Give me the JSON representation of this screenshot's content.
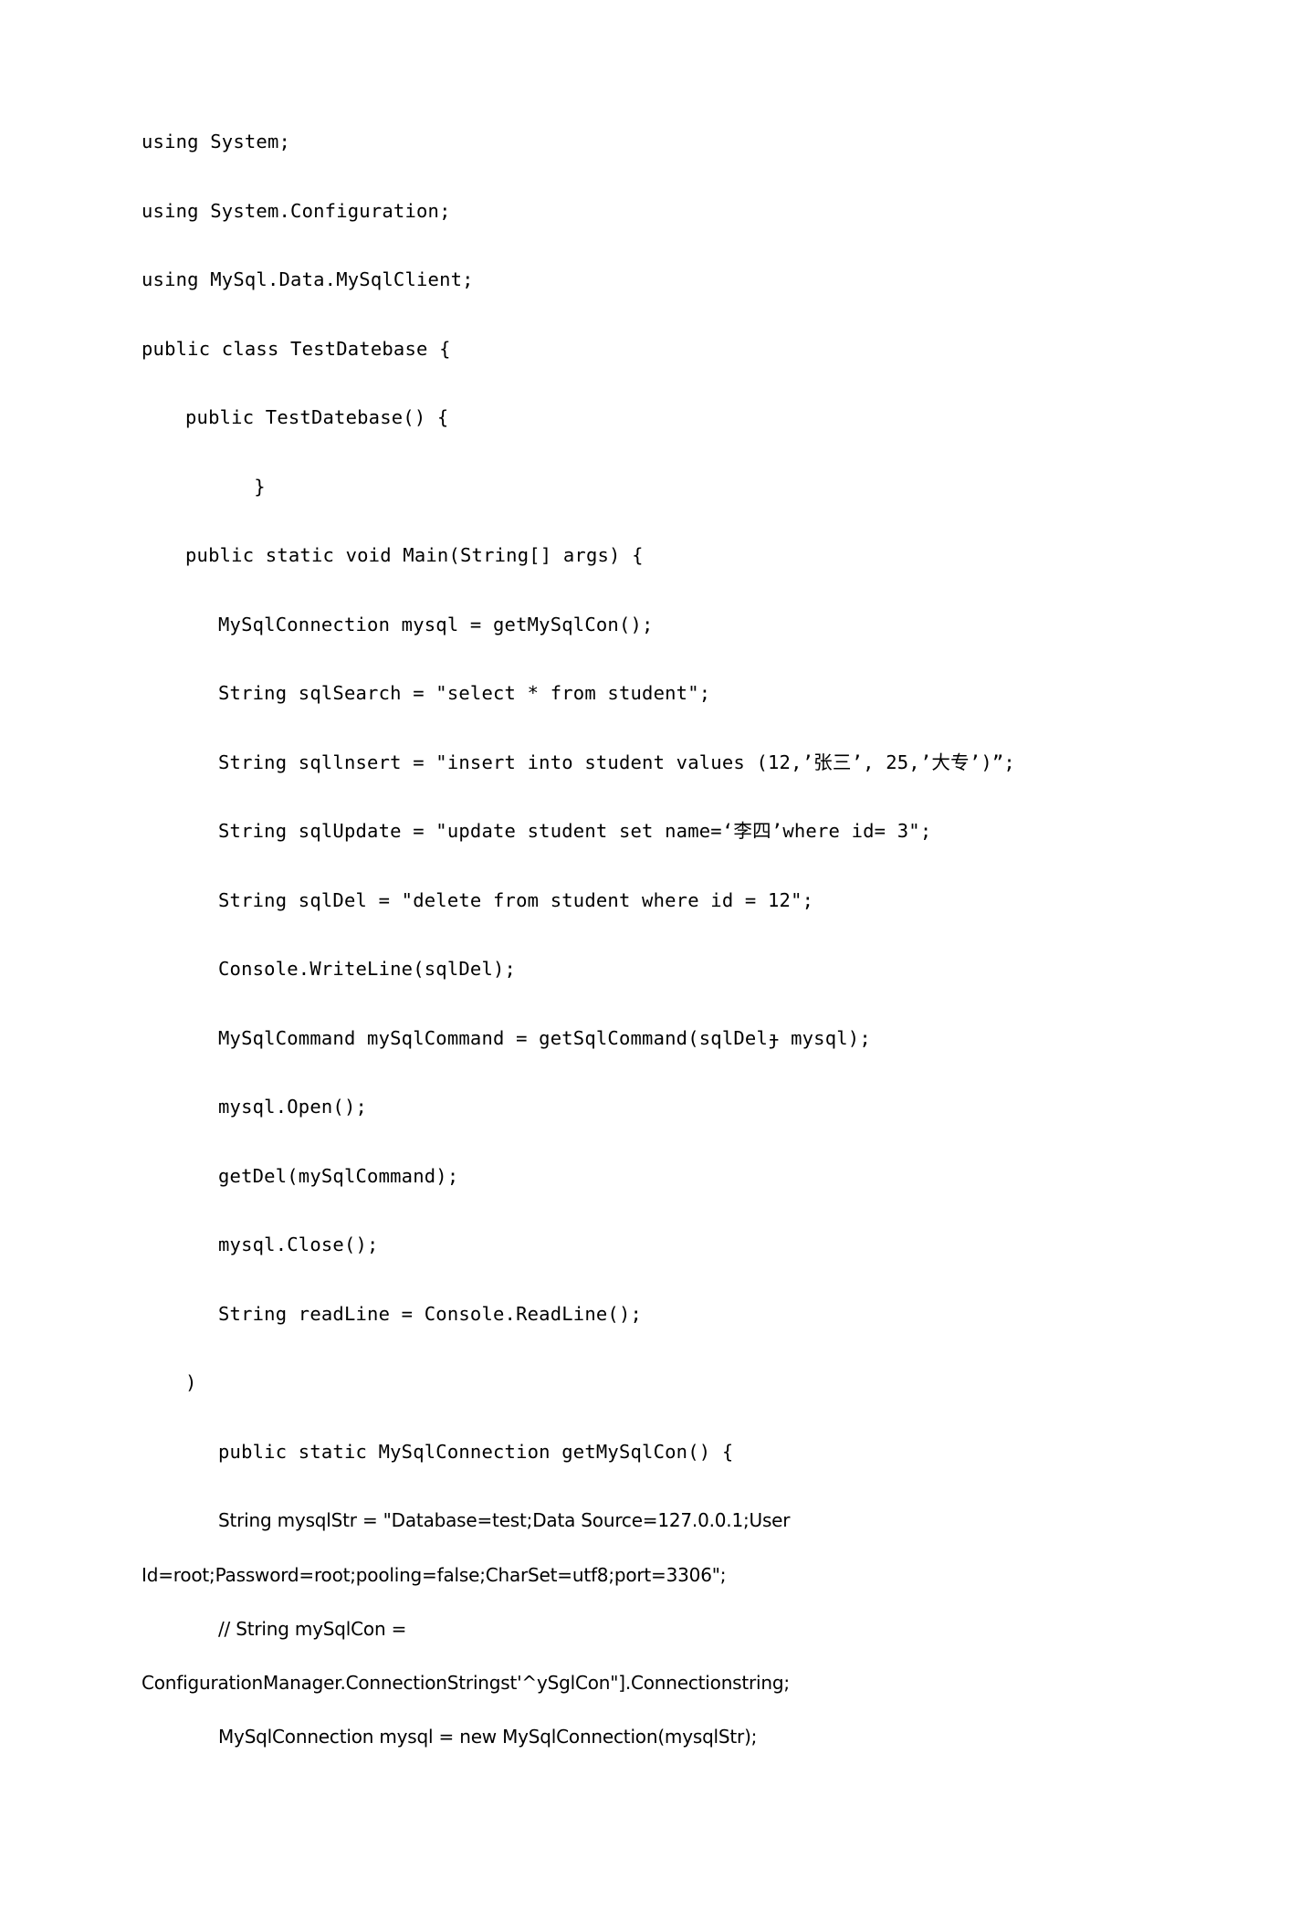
{
  "document": {
    "kind": "word-processor-page",
    "page_background": "#ffffff",
    "text_color": "#000000",
    "language": "csharp"
  },
  "code": {
    "lines": [
      {
        "id": "line-1",
        "indent": 0,
        "text": "using System;"
      },
      {
        "id": "line-2",
        "indent": 0,
        "text": "using System.Configuration;"
      },
      {
        "id": "line-3",
        "indent": 0,
        "text": "using MySql.Data.MySqlClient;"
      },
      {
        "id": "line-4",
        "indent": 0,
        "text": "public class TestDatebase {"
      },
      {
        "id": "line-5",
        "indent": 1,
        "text": "public TestDatebase() {"
      },
      {
        "id": "line-6",
        "indent": 2,
        "text": "      }"
      },
      {
        "id": "line-7",
        "indent": 1,
        "text": "public static void Main(String[] args) {"
      },
      {
        "id": "line-8",
        "indent": 2,
        "text": "MySqlConnection mysql = getMySqlCon();"
      },
      {
        "id": "line-9",
        "indent": 2,
        "text": "String sqlSearch = \"select * from student\";"
      },
      {
        "id": "line-10",
        "indent": 2,
        "text": "String sqllnsert = \"insert into student values (12,’张三’, 25,’大专’)”;"
      },
      {
        "id": "line-11",
        "indent": 2,
        "text": "String sqlUpdate = \"update student set name=‘李四’where id= 3\";"
      },
      {
        "id": "line-12",
        "indent": 2,
        "text": "String sqlDel = \"delete from student where id = 12\";"
      },
      {
        "id": "line-13",
        "indent": 2,
        "text": "Console.WriteLine(sqlDel);"
      },
      {
        "id": "line-14",
        "indent": 2,
        "text": "MySqlCommand mySqlCommand = getSqlCommand(sqlDelɟ mysql);"
      },
      {
        "id": "line-15",
        "indent": 2,
        "text": "mysql.Open();"
      },
      {
        "id": "line-16",
        "indent": 2,
        "text": "getDel(mySqlCommand);"
      },
      {
        "id": "line-17",
        "indent": 2,
        "text": "mysql.Close();"
      },
      {
        "id": "line-18",
        "indent": 2,
        "text": "String readLine = Console.ReadLine();"
      },
      {
        "id": "line-19",
        "indent": 1,
        "text": ")"
      },
      {
        "id": "line-20",
        "indent": 2,
        "text": "public static MySqlConnection getMySqlCon() {"
      },
      {
        "id": "line-21",
        "indent": 2,
        "text": "String mysqlStr = \"Database=test;Data Source=127.0.0.1;User"
      },
      {
        "id": "line-22",
        "indent": 0,
        "wrap": true,
        "text": "Id=root;Password=root;pooling=false;CharSet=utf8;port=3306\";"
      },
      {
        "id": "line-23",
        "indent": 2,
        "text": "// String mySqlCon ="
      },
      {
        "id": "line-24",
        "indent": 0,
        "wrap": true,
        "text": "ConfigurationManager.ConnectionStringst'^ySglCon\"].Connectionstring;"
      },
      {
        "id": "line-25",
        "indent": 2,
        "text": "MySqlConnection mysql = new MySqlConnection(mysqlStr);"
      }
    ]
  }
}
